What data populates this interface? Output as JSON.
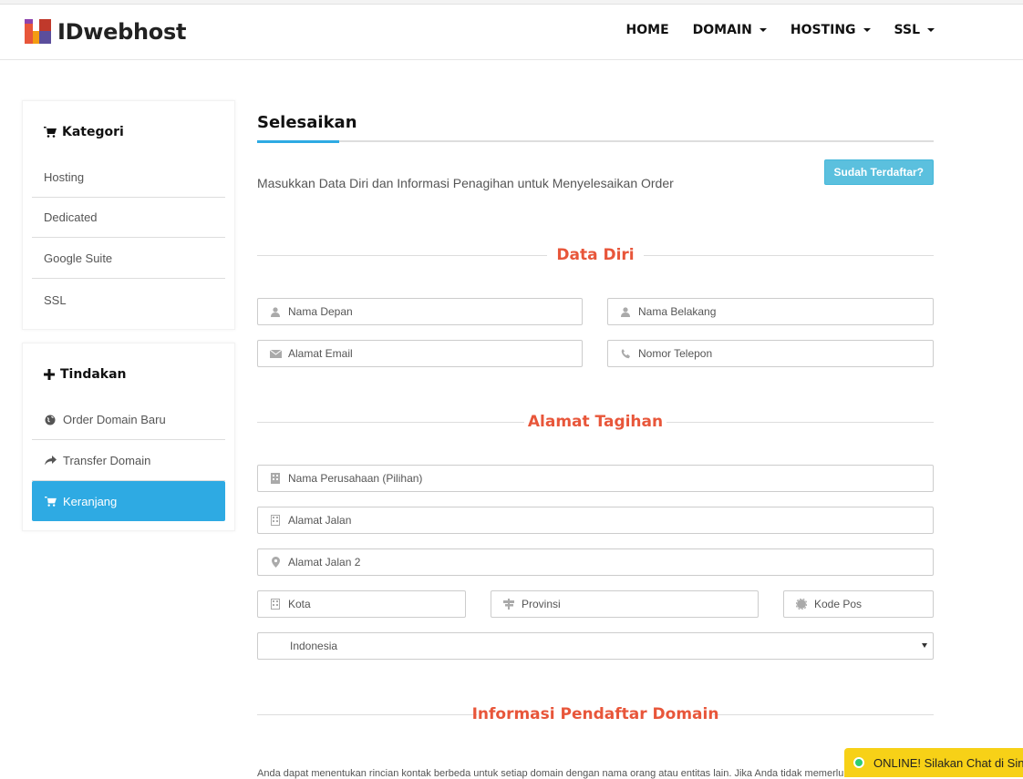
{
  "brand": {
    "name": "IDwebhost"
  },
  "nav": {
    "items": [
      {
        "label": "HOME",
        "dropdown": false
      },
      {
        "label": "DOMAIN",
        "dropdown": true
      },
      {
        "label": "HOSTING",
        "dropdown": true
      },
      {
        "label": "SSL",
        "dropdown": true
      }
    ]
  },
  "sidebar": {
    "kategori": {
      "title": "Kategori",
      "items": [
        "Hosting",
        "Dedicated",
        "Google Suite",
        "SSL"
      ]
    },
    "tindakan": {
      "title": "Tindakan",
      "items": [
        {
          "label": "Order Domain Baru",
          "icon": "globe-icon"
        },
        {
          "label": "Transfer Domain",
          "icon": "share-arrow-icon"
        },
        {
          "label": "Keranjang",
          "icon": "cart-icon",
          "active": true
        }
      ]
    }
  },
  "main": {
    "title": "Selesaikan",
    "subtitle": "Masukkan Data Diri dan Informasi Penagihan untuk Menyelesaikan Order",
    "registered_button": "Sudah Terdaftar?",
    "sections": {
      "data_diri": "Data Diri",
      "alamat_tagihan": "Alamat Tagihan",
      "informasi_pendaftar": "Informasi Pendaftar Domain"
    },
    "fields": {
      "first_name": "Nama Depan",
      "last_name": "Nama Belakang",
      "email": "Alamat Email",
      "phone": "Nomor Telepon",
      "company": "Nama Perusahaan (Pilihan)",
      "address1": "Alamat Jalan",
      "address2": "Alamat Jalan 2",
      "city": "Kota",
      "state": "Provinsi",
      "postcode": "Kode Pos"
    },
    "country": {
      "selected": "Indonesia"
    },
    "domain_note": "Anda dapat menentukan rincian kontak berbeda untuk setiap domain dengan nama orang atau entitas lain. Jika Anda tidak memerlukan"
  },
  "chat": {
    "label": "ONLINE! Silakan Chat di Sini"
  },
  "colors": {
    "accent": "#2eaae3",
    "heading": "#e8563a",
    "chat": "#f7d117",
    "button": "#5bc0de"
  }
}
